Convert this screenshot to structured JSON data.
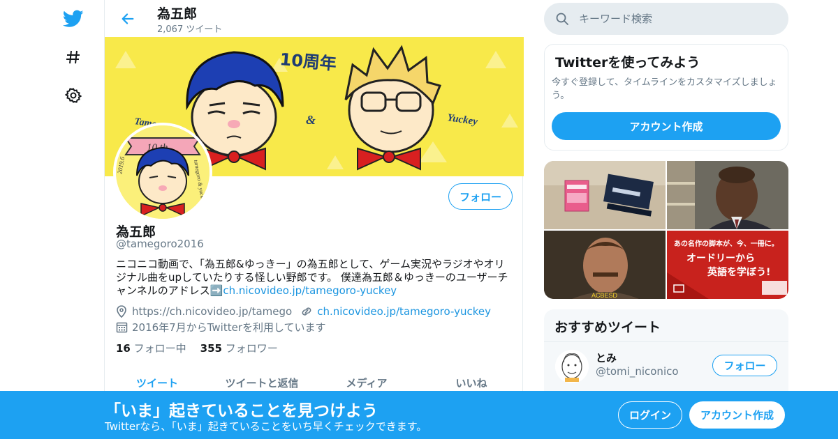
{
  "header": {
    "title": "為五郎",
    "tweet_count": "2,067 ツイート"
  },
  "banner": {
    "left_name": "Tamegoro",
    "ampersand": "&",
    "right_name": "Yuckey",
    "anniversary": "10周年"
  },
  "avatar_badge": {
    "ribbon_text": "10 th",
    "side_text": "tamegoro & yuckey",
    "year_text": "2019.6"
  },
  "profile": {
    "name": "為五郎",
    "handle": "@tamegoro2016",
    "follow_label": "フォロー",
    "bio_text": "ニコニコ動画で、「為五郎&ゆっきー」の為五郎として、ゲーム実況やラジオやオリジナル曲をupしていたりする怪しい野郎です。 僕達為五郎＆ゆっきーのユーザーチャンネルのアドレス",
    "bio_emoji": "➡️",
    "bio_link": "ch.nicovideo.jp/tamegoro-yuckey",
    "location": "https://ch.nicovideo.jp/tamego",
    "website": "ch.nicovideo.jp/tamegoro-yuckey",
    "joined": "2016年7月からTwitterを利用しています",
    "following_count": "16",
    "following_label": "フォロー中",
    "followers_count": "355",
    "followers_label": "フォロワー"
  },
  "tabs": [
    "ツイート",
    "ツイートと返信",
    "メディア",
    "いいね"
  ],
  "search": {
    "placeholder": "キーワード検索"
  },
  "signup_card": {
    "title": "Twitterを使ってみよう",
    "text": "今すぐ登録して、タイムラインをカスタマイズしましょう。",
    "button": "アカウント作成"
  },
  "media": {
    "tile4_line1": "あの名作の脚本が、今、一冊に。",
    "tile4_line2": "オードリーから",
    "tile4_line3": "英語を学ぼう!",
    "tile3_caption": "ACBESD"
  },
  "recommendations": {
    "title": "おすすめツイート",
    "items": [
      {
        "name": "とみ",
        "handle": "@tomi_niconico",
        "follow_label": "フォロー"
      }
    ]
  },
  "bottom_bar": {
    "title": "「いま」起きていることを見つけよう",
    "subtitle": "Twitterなら、「いま」起きていることをいち早くチェックできます。",
    "login": "ログイン",
    "signup": "アカウント作成"
  },
  "colors": {
    "accent": "#1da1f2",
    "banner_yellow": "#f8e94a",
    "secondary_text": "#657786"
  },
  "icons": [
    "twitter-bird-icon",
    "hashtag-icon",
    "gear-icon",
    "back-arrow-icon",
    "search-icon",
    "location-icon",
    "link-icon",
    "calendar-icon"
  ]
}
